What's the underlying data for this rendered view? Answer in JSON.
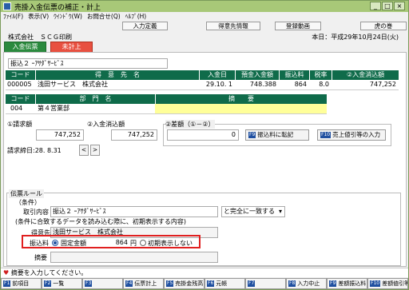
{
  "window": {
    "title": "売掛入金伝票の補正・計上"
  },
  "menu": [
    "ﾌｧｲﾙ(F)",
    "表示(V)",
    "ｳｲﾝﾄﾞｳ(W)",
    "お問合せ(Q)",
    "ﾍﾙﾌﾟ(H)"
  ],
  "toolbar": [
    "入力定義",
    "得意先情報",
    "登録動画",
    "虎の巻"
  ],
  "header": {
    "company": "株式会社　ＳＣＧ印刷",
    "date": "本日：平成29年10月24日(火)"
  },
  "tabs": {
    "active": "入金伝票",
    "inactive": "未計上"
  },
  "desc": "振込２ ｰｱｻﾀﾞｻｰﾋﾞｽ",
  "grid1": {
    "headers": [
      "コード",
      "得　意　先　名",
      "入金日",
      "預金入金額",
      "振込料",
      "税率",
      "②入金消込額"
    ],
    "row": [
      "000005",
      "浅田サービス　株式会社",
      "29.10. 1",
      "748.388",
      "864",
      "8.0",
      "747,252"
    ]
  },
  "grid2": {
    "headers": [
      "コード",
      "部　門　名",
      "摘　　要"
    ],
    "row": [
      "004",
      "第４営業部",
      ""
    ]
  },
  "summary": {
    "bill_label": "①請求額",
    "bill_value": "747,252",
    "clear_label": "②入金消込額",
    "clear_value": "747,252",
    "diff_label": "②差額（①－②）",
    "diff_value": "0",
    "btn_transfer": "振込料に転記",
    "btn_discount": "売上値引等の入力",
    "close_label": "請求締日:28. 8.31"
  },
  "rule": {
    "legend": "伝票ルール",
    "cond_label": "（条件）",
    "txn_label": "取引内容",
    "txn_value": "振込２ ｰｱｻﾀﾞｻｰﾋﾞｽ",
    "match_value": "と完全に一致する",
    "note": "(条件に合致するデータを読み込む際に、初期表示する内容)",
    "cust_label": "得意先",
    "cust_value": "浅田サービス　株式会社",
    "fee_label": "振込料",
    "radio_fixed": "固定金額",
    "fee_amount": "864",
    "fee_unit": "円",
    "radio_none": "初期表示しない",
    "summary_label": "摘要"
  },
  "status": "摘要を入力してください。",
  "fkeys": [
    {
      "key": "F1",
      "label": "前項目"
    },
    {
      "key": "F2",
      "label": "一覧"
    },
    {
      "key": "F3",
      "label": ""
    },
    {
      "key": "F4",
      "label": "伝票計上"
    },
    {
      "key": "F5",
      "label": "売掛金残高"
    },
    {
      "key": "F6",
      "label": "元帳"
    },
    {
      "key": "F7",
      "label": ""
    },
    {
      "key": "F8",
      "label": "入力中止"
    },
    {
      "key": "F9",
      "label": "差額振込料"
    },
    {
      "key": "F10",
      "label": "差額値引等"
    }
  ],
  "colors": {
    "title": "#a8c878",
    "grid_header": "#0f6b4a",
    "tab_active": "#2b8a3e",
    "tab_inactive": "#e85040",
    "highlight": "#e02020",
    "summary_input": "#ffff99"
  }
}
